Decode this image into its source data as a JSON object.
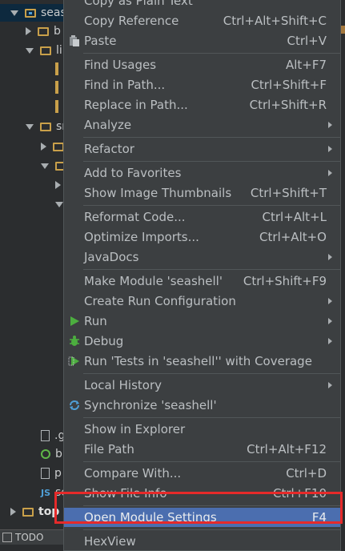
{
  "tree": [
    {
      "label": "seas",
      "arrow": "down",
      "icon": "module-folder",
      "sel": true
    },
    {
      "label": "b",
      "arrow": "right",
      "icon": "folder"
    },
    {
      "label": "li",
      "arrow": "down",
      "icon": "folder"
    },
    {
      "label": "",
      "arrow": "",
      "icon": "file-bar"
    },
    {
      "label": "",
      "arrow": "",
      "icon": "file-bar"
    },
    {
      "label": "",
      "arrow": "",
      "icon": "file-bar"
    },
    {
      "label": "sr",
      "arrow": "down",
      "icon": "folder"
    },
    {
      "label": "",
      "arrow": "right",
      "icon": "folder"
    },
    {
      "label": "",
      "arrow": "down",
      "icon": "folder"
    },
    {
      "label": "",
      "arrow": "right",
      "icon": ""
    },
    {
      "label": "",
      "arrow": "down",
      "icon": ""
    },
    {
      "label": ".g",
      "arrow": "",
      "icon": "file"
    },
    {
      "label": "b",
      "arrow": "",
      "icon": "circle"
    },
    {
      "label": "p",
      "arrow": "",
      "icon": "file"
    },
    {
      "label": "se",
      "arrow": "",
      "icon": "js"
    },
    {
      "label": "top",
      "arrow": "right",
      "icon": "folder"
    }
  ],
  "status_bar": {
    "label": "TODO"
  },
  "menu": {
    "items": [
      {
        "label": "Copy as Plain Text",
        "shortcut": "",
        "submenu": false,
        "icon": ""
      },
      {
        "label": "Copy Reference",
        "shortcut": "Ctrl+Alt+Shift+C",
        "submenu": false,
        "icon": ""
      },
      {
        "label": "Paste",
        "shortcut": "Ctrl+V",
        "submenu": false,
        "icon": "paste-icon"
      },
      {
        "sep": true
      },
      {
        "label": "Find Usages",
        "shortcut": "Alt+F7",
        "submenu": false,
        "icon": ""
      },
      {
        "label": "Find in Path...",
        "shortcut": "Ctrl+Shift+F",
        "submenu": false,
        "icon": ""
      },
      {
        "label": "Replace in Path...",
        "shortcut": "Ctrl+Shift+R",
        "submenu": false,
        "icon": ""
      },
      {
        "label": "Analyze",
        "shortcut": "",
        "submenu": true,
        "icon": ""
      },
      {
        "sep": true
      },
      {
        "label": "Refactor",
        "shortcut": "",
        "submenu": true,
        "icon": ""
      },
      {
        "sep": true
      },
      {
        "label": "Add to Favorites",
        "shortcut": "",
        "submenu": true,
        "icon": ""
      },
      {
        "label": "Show Image Thumbnails",
        "shortcut": "Ctrl+Shift+T",
        "submenu": false,
        "icon": ""
      },
      {
        "sep": true
      },
      {
        "label": "Reformat Code...",
        "shortcut": "Ctrl+Alt+L",
        "submenu": false,
        "icon": ""
      },
      {
        "label": "Optimize Imports...",
        "shortcut": "Ctrl+Alt+O",
        "submenu": false,
        "icon": ""
      },
      {
        "label": "JavaDocs",
        "shortcut": "",
        "submenu": true,
        "icon": ""
      },
      {
        "sep": true
      },
      {
        "label": "Make Module 'seashell'",
        "shortcut": "Ctrl+Shift+F9",
        "submenu": false,
        "icon": ""
      },
      {
        "label": "Create Run Configuration",
        "shortcut": "",
        "submenu": true,
        "icon": ""
      },
      {
        "label": "Run",
        "shortcut": "",
        "submenu": true,
        "icon": "run-icon"
      },
      {
        "label": "Debug",
        "shortcut": "",
        "submenu": true,
        "icon": "debug-icon"
      },
      {
        "label": "Run 'Tests in 'seashell'' with Coverage",
        "shortcut": "",
        "submenu": false,
        "icon": "coverage-icon"
      },
      {
        "sep": true
      },
      {
        "label": "Local History",
        "shortcut": "",
        "submenu": true,
        "icon": ""
      },
      {
        "label": "Synchronize 'seashell'",
        "shortcut": "",
        "submenu": false,
        "icon": "sync-icon"
      },
      {
        "sep": true
      },
      {
        "label": "Show in Explorer",
        "shortcut": "",
        "submenu": false,
        "icon": ""
      },
      {
        "label": "File Path",
        "shortcut": "Ctrl+Alt+F12",
        "submenu": false,
        "icon": ""
      },
      {
        "sep": true
      },
      {
        "label": "Compare With...",
        "shortcut": "Ctrl+D",
        "submenu": false,
        "icon": ""
      },
      {
        "label": "Show File Info",
        "shortcut": "Ctrl+F10",
        "submenu": false,
        "icon": ""
      },
      {
        "sep": true
      },
      {
        "label": "Open Module Settings",
        "shortcut": "F4",
        "submenu": false,
        "icon": "",
        "highlighted": true
      },
      {
        "sep": true
      },
      {
        "label": "HexView",
        "shortcut": "",
        "submenu": false,
        "icon": ""
      }
    ]
  },
  "colors": {
    "highlight": "#4b6eaf",
    "menu_bg": "#3c3f41",
    "annotation": "#e62a2a"
  }
}
